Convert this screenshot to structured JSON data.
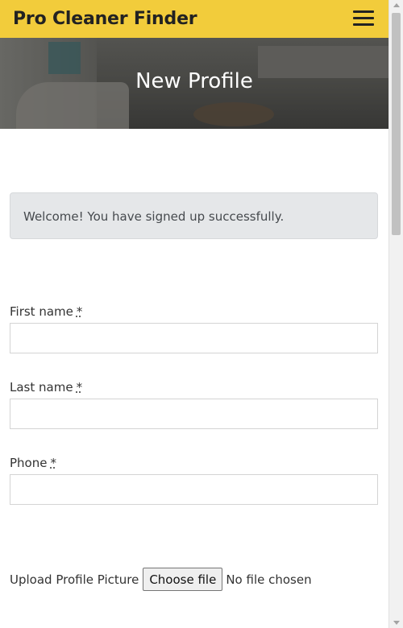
{
  "navbar": {
    "brand": "Pro Cleaner Finder",
    "menu_icon": "hamburger-menu-icon",
    "background_color": "#f2cc3b"
  },
  "hero": {
    "title": "New Profile"
  },
  "alert": {
    "message": "Welcome! You have signed up successfully."
  },
  "form": {
    "first_name": {
      "label": "First name",
      "required_marker": "*",
      "value": ""
    },
    "last_name": {
      "label": "Last name",
      "required_marker": "*",
      "value": ""
    },
    "phone": {
      "label": "Phone",
      "required_marker": "*",
      "value": ""
    },
    "upload": {
      "label": "Upload Profile Picture",
      "button": "Choose file",
      "status": "No file chosen"
    }
  }
}
